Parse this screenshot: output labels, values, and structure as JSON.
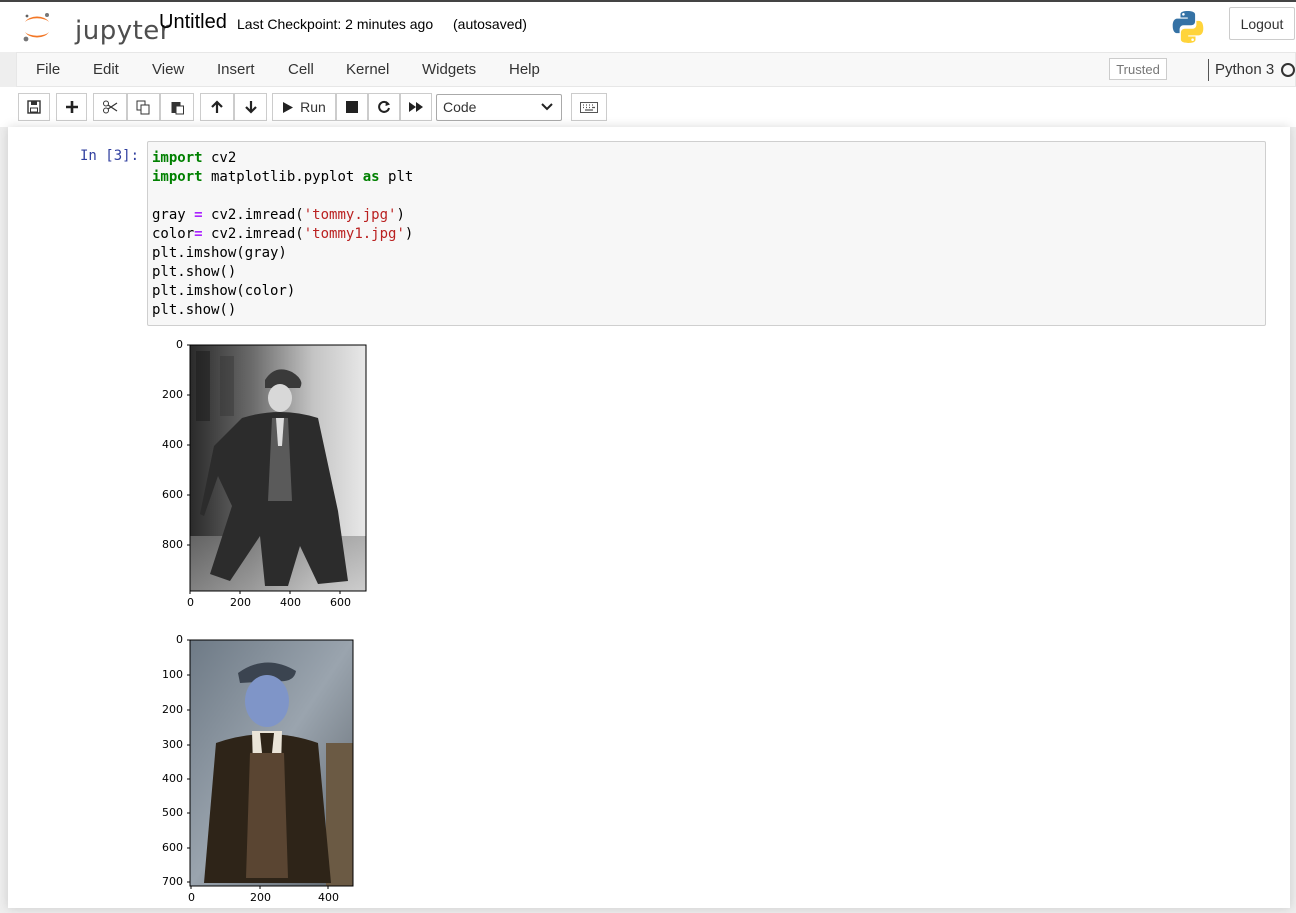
{
  "header": {
    "logo_text": "jupyter",
    "notebook_title": "Untitled",
    "checkpoint": "Last Checkpoint: 2 minutes ago",
    "autosave": "(autosaved)",
    "logout_label": "Logout"
  },
  "menu": {
    "items": [
      "File",
      "Edit",
      "View",
      "Insert",
      "Cell",
      "Kernel",
      "Widgets",
      "Help"
    ],
    "trusted": "Trusted",
    "kernel_name": "Python 3"
  },
  "toolbar": {
    "run_label": "Run",
    "cell_type": "Code",
    "buttons": [
      "save-icon",
      "plus-icon",
      "cut-icon",
      "copy-icon",
      "paste-icon",
      "arrow-up-icon",
      "arrow-down-icon",
      "run-icon",
      "stop-icon",
      "restart-icon",
      "fast-forward-icon",
      "keyboard-icon"
    ]
  },
  "cell": {
    "prompt": "In [3]:",
    "code_lines": [
      [
        {
          "t": "import",
          "c": "kw"
        },
        {
          "t": " cv2"
        }
      ],
      [
        {
          "t": "import",
          "c": "kw"
        },
        {
          "t": " matplotlib.pyplot "
        },
        {
          "t": "as",
          "c": "kw"
        },
        {
          "t": " plt"
        }
      ],
      [],
      [
        {
          "t": "gray "
        },
        {
          "t": "=",
          "c": "op"
        },
        {
          "t": " cv2.imread("
        },
        {
          "t": "'tommy.jpg'",
          "c": "str"
        },
        {
          "t": ")"
        }
      ],
      [
        {
          "t": "color"
        },
        {
          "t": "=",
          "c": "op"
        },
        {
          "t": " cv2.imread("
        },
        {
          "t": "'tommy1.jpg'",
          "c": "str"
        },
        {
          "t": ")"
        }
      ],
      [
        {
          "t": "plt.imshow(gray)"
        }
      ],
      [
        {
          "t": "plt.show()"
        }
      ],
      [
        {
          "t": "plt.imshow(color)"
        }
      ],
      [
        {
          "t": "plt.show()"
        }
      ]
    ]
  },
  "outputs": [
    {
      "name": "gray-image-plot",
      "y_ticks": [
        "0",
        "200",
        "400",
        "600",
        "800"
      ],
      "x_ticks": [
        "0",
        "200",
        "400",
        "600"
      ]
    },
    {
      "name": "color-image-plot",
      "y_ticks": [
        "0",
        "100",
        "200",
        "300",
        "400",
        "500",
        "600",
        "700"
      ],
      "x_ticks": [
        "0",
        "200",
        "400"
      ]
    }
  ]
}
